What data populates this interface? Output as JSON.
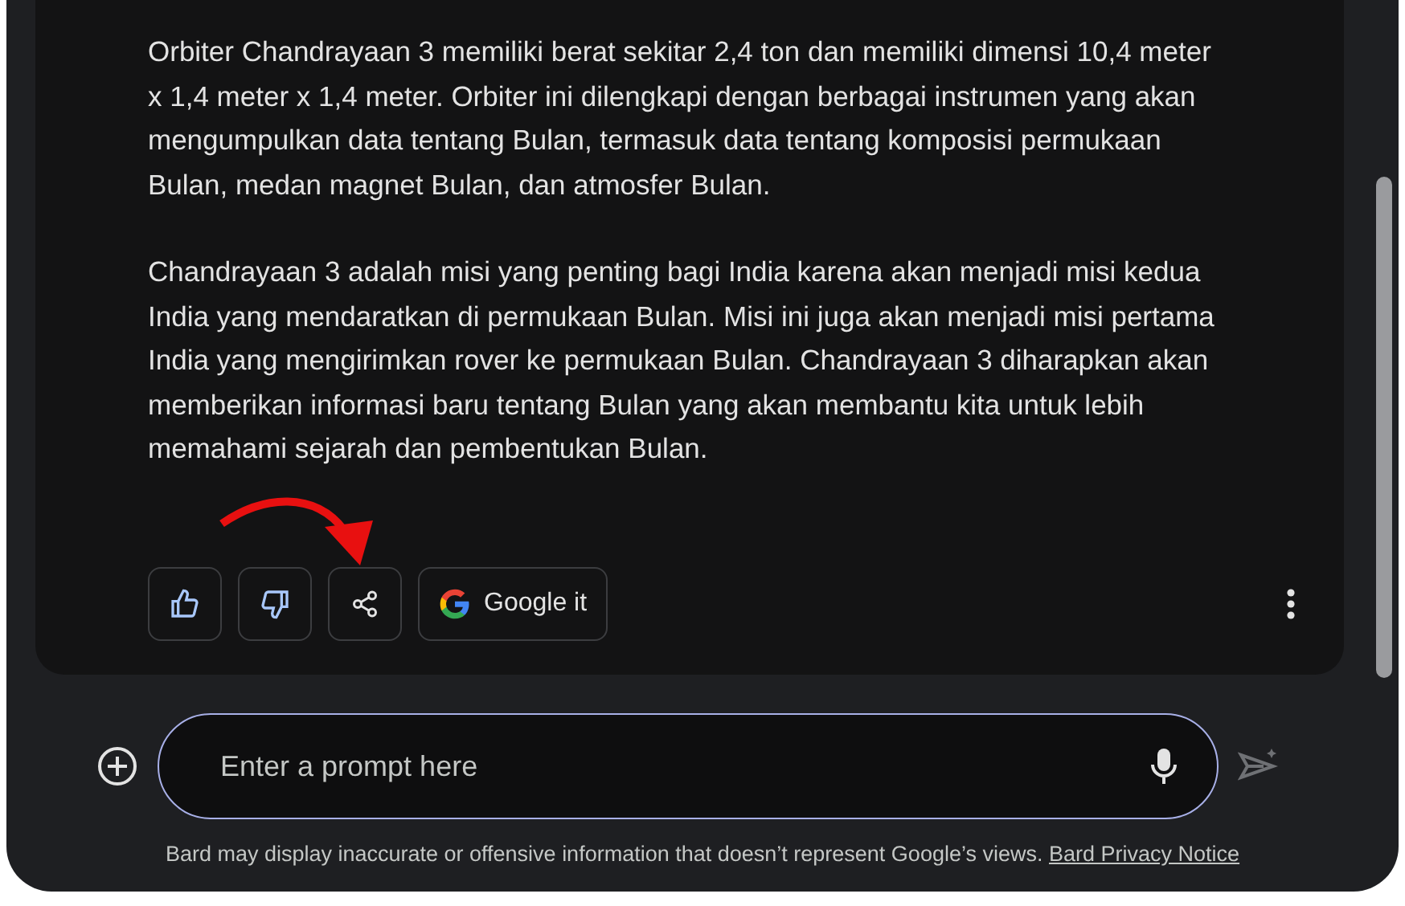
{
  "response": {
    "paragraphs": [
      "Orbiter Chandrayaan 3 memiliki berat sekitar 2,4 ton dan memiliki dimensi 10,4 meter x 1,4 meter x 1,4 meter. Orbiter ini dilengkapi dengan berbagai instrumen yang akan mengumpulkan data tentang Bulan, termasuk data tentang komposisi permukaan Bulan, medan magnet Bulan, dan atmosfer Bulan.",
      "Chandrayaan 3 adalah misi yang penting bagi India karena akan menjadi misi kedua India yang mendaratkan di permukaan Bulan. Misi ini juga akan menjadi misi pertama India yang mengirimkan rover ke permukaan Bulan. Chandrayaan 3 diharapkan akan memberikan informasi baru tentang Bulan yang akan membantu kita untuk lebih memahami sejarah dan pembentukan Bulan."
    ]
  },
  "actions": [
    {
      "kind": "like"
    },
    {
      "kind": "dislike"
    },
    {
      "kind": "share"
    },
    {
      "kind": "google",
      "label": "Google it"
    }
  ],
  "prompt": {
    "placeholder": "Enter a prompt here"
  },
  "footer": {
    "disclaimer": "Bard may display inaccurate or offensive information that doesn’t represent Google’s views.",
    "link": "Bard Privacy Notice"
  }
}
